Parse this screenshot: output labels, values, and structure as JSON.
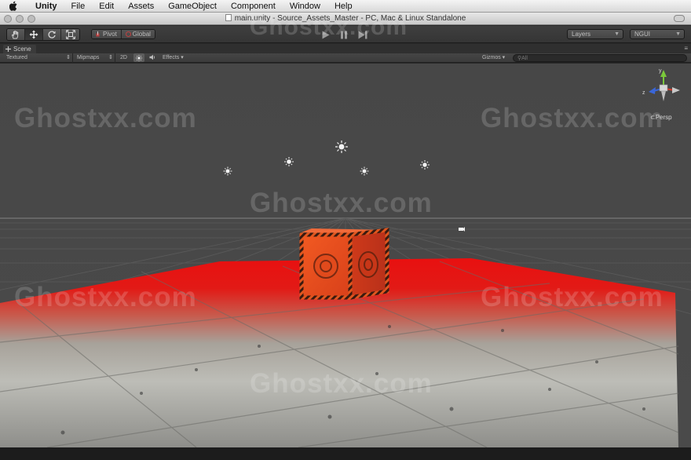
{
  "menubar": {
    "items": [
      "Unity",
      "File",
      "Edit",
      "Assets",
      "GameObject",
      "Component",
      "Window",
      "Help"
    ]
  },
  "window": {
    "title": "main.unity - Source_Assets_Master - PC, Mac & Linux Standalone"
  },
  "toolbar": {
    "tools": [
      "hand-tool",
      "move-tool",
      "rotate-tool",
      "scale-tool"
    ],
    "pivot_label": "Pivot",
    "global_label": "Global",
    "layers_label": "Layers",
    "layout_label": "NGUI"
  },
  "scene": {
    "tab_label": "Scene",
    "draw_mode": "Textured",
    "mipmaps": "Mipmaps",
    "mode_2d": "2D",
    "effects": "Effects",
    "gizmos": "Gizmos",
    "search_placeholder": "All",
    "persp_label": "Persp",
    "gizmo_axes": {
      "x": "x",
      "y": "y",
      "z": "z"
    }
  },
  "watermark": "Ghostxx.com",
  "colors": {
    "accent_red": "#e81010",
    "crate_orange": "#e4501e",
    "axis_x": "#d83a2a",
    "axis_y": "#7ac83a",
    "axis_z": "#3a66d8"
  }
}
